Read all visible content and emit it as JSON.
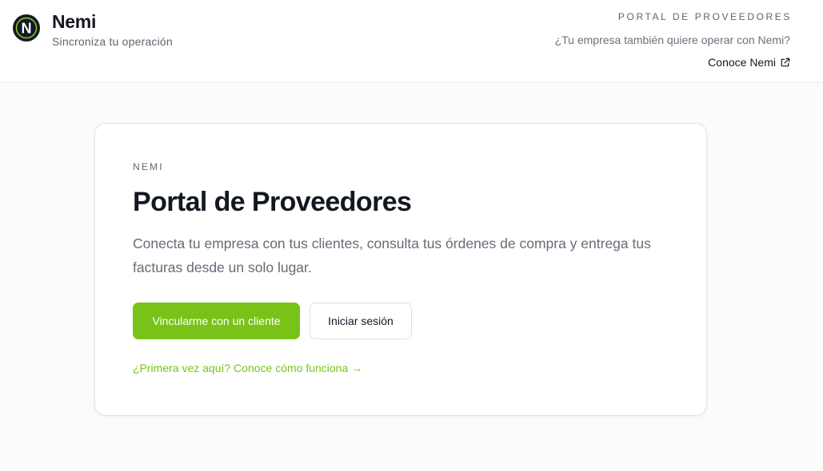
{
  "header": {
    "brand_name": "Nemi",
    "tagline": "Sincroniza tu operación",
    "logo_letter": "N",
    "portal_kicker": "PORTAL DE PROVEEDORES",
    "question": "¿Tu empresa también quiere operar con Nemi?",
    "learn_link": "Conoce Nemi",
    "learn_link_icon": "external-link-icon",
    "logo_icon": "nemi-logo-icon"
  },
  "card": {
    "eyebrow": "NEMI",
    "title": "Portal de Proveedores",
    "description": "Conecta tu empresa con tus clientes, consulta tus órdenes de compra y entrega tus facturas desde un solo lugar.",
    "primary_button": "Vincularme con un cliente",
    "secondary_button": "Iniciar sesión",
    "first_time_link": "¿Primera vez aquí? Conoce cómo funciona →"
  },
  "colors": {
    "accent": "#79c318",
    "text_dark": "#121722",
    "text_muted": "#666b76",
    "background": "#fbfbfb"
  }
}
